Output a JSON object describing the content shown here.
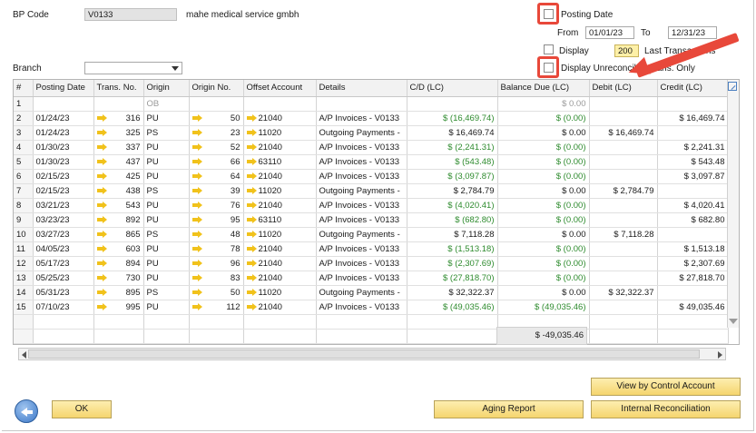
{
  "header": {
    "bp_code_label": "BP Code",
    "bp_code_value": "V0133",
    "bp_name": "mahe medical service gmbh",
    "branch_label": "Branch",
    "branch_value": ""
  },
  "filters": {
    "posting_date_label": "Posting Date",
    "from_label": "From",
    "from_value": "01/01/23",
    "to_label": "To",
    "to_value": "12/31/23",
    "display_label": "Display",
    "display_count": "200",
    "last_transactions_label": "Last Transactions",
    "unreconciled_label": "Display Unreconciled Trans. Only"
  },
  "grid": {
    "columns": [
      "#",
      "Posting Date",
      "Trans. No.",
      "Origin",
      "Origin No.",
      "Offset Account",
      "Details",
      "C/D (LC)",
      "Balance Due (LC)",
      "Debit (LC)",
      "Credit (LC)"
    ],
    "opening_row": {
      "num": "1",
      "origin": "OB",
      "balance_due": "$ 0.00"
    },
    "rows": [
      {
        "num": "2",
        "date": "01/24/23",
        "trans": "316",
        "origin": "PU",
        "origin_no": "50",
        "offset": "21040",
        "details": "A/P Invoices - V0133",
        "cd": "$ (16,469.74)",
        "bal": "$ (0.00)",
        "debit": "",
        "credit": "$ 16,469.74"
      },
      {
        "num": "3",
        "date": "01/24/23",
        "trans": "325",
        "origin": "PS",
        "origin_no": "23",
        "offset": "11020",
        "details": "Outgoing Payments -",
        "cd": "$ 16,469.74",
        "bal": "$ 0.00",
        "debit": "$ 16,469.74",
        "credit": ""
      },
      {
        "num": "4",
        "date": "01/30/23",
        "trans": "337",
        "origin": "PU",
        "origin_no": "52",
        "offset": "21040",
        "details": "A/P Invoices - V0133",
        "cd": "$ (2,241.31)",
        "bal": "$ (0.00)",
        "debit": "",
        "credit": "$ 2,241.31"
      },
      {
        "num": "5",
        "date": "01/30/23",
        "trans": "437",
        "origin": "PU",
        "origin_no": "66",
        "offset": "63110",
        "details": "A/P Invoices - V0133",
        "cd": "$ (543.48)",
        "bal": "$ (0.00)",
        "debit": "",
        "credit": "$ 543.48"
      },
      {
        "num": "6",
        "date": "02/15/23",
        "trans": "425",
        "origin": "PU",
        "origin_no": "64",
        "offset": "21040",
        "details": "A/P Invoices - V0133",
        "cd": "$ (3,097.87)",
        "bal": "$ (0.00)",
        "debit": "",
        "credit": "$ 3,097.87"
      },
      {
        "num": "7",
        "date": "02/15/23",
        "trans": "438",
        "origin": "PS",
        "origin_no": "39",
        "offset": "11020",
        "details": "Outgoing Payments -",
        "cd": "$ 2,784.79",
        "bal": "$ 0.00",
        "debit": "$ 2,784.79",
        "credit": ""
      },
      {
        "num": "8",
        "date": "03/21/23",
        "trans": "543",
        "origin": "PU",
        "origin_no": "76",
        "offset": "21040",
        "details": "A/P Invoices - V0133",
        "cd": "$ (4,020.41)",
        "bal": "$ (0.00)",
        "debit": "",
        "credit": "$ 4,020.41"
      },
      {
        "num": "9",
        "date": "03/23/23",
        "trans": "892",
        "origin": "PU",
        "origin_no": "95",
        "offset": "63110",
        "details": "A/P Invoices - V0133",
        "cd": "$ (682.80)",
        "bal": "$ (0.00)",
        "debit": "",
        "credit": "$ 682.80"
      },
      {
        "num": "10",
        "date": "03/27/23",
        "trans": "865",
        "origin": "PS",
        "origin_no": "48",
        "offset": "11020",
        "details": "Outgoing Payments -",
        "cd": "$ 7,118.28",
        "bal": "$ 0.00",
        "debit": "$ 7,118.28",
        "credit": ""
      },
      {
        "num": "11",
        "date": "04/05/23",
        "trans": "603",
        "origin": "PU",
        "origin_no": "78",
        "offset": "21040",
        "details": "A/P Invoices - V0133",
        "cd": "$ (1,513.18)",
        "bal": "$ (0.00)",
        "debit": "",
        "credit": "$ 1,513.18"
      },
      {
        "num": "12",
        "date": "05/17/23",
        "trans": "894",
        "origin": "PU",
        "origin_no": "96",
        "offset": "21040",
        "details": "A/P Invoices - V0133",
        "cd": "$ (2,307.69)",
        "bal": "$ (0.00)",
        "debit": "",
        "credit": "$ 2,307.69"
      },
      {
        "num": "13",
        "date": "05/25/23",
        "trans": "730",
        "origin": "PU",
        "origin_no": "83",
        "offset": "21040",
        "details": "A/P Invoices - V0133",
        "cd": "$ (27,818.70)",
        "bal": "$ (0.00)",
        "debit": "",
        "credit": "$ 27,818.70"
      },
      {
        "num": "14",
        "date": "05/31/23",
        "trans": "895",
        "origin": "PS",
        "origin_no": "50",
        "offset": "11020",
        "details": "Outgoing Payments -",
        "cd": "$ 32,322.37",
        "bal": "$ 0.00",
        "debit": "$ 32,322.37",
        "credit": ""
      },
      {
        "num": "15",
        "date": "07/10/23",
        "trans": "995",
        "origin": "PU",
        "origin_no": "112",
        "offset": "21040",
        "details": "A/P Invoices - V0133",
        "cd": "$ (49,035.46)",
        "bal": "$ (49,035.46)",
        "debit": "",
        "credit": "$ 49,035.46"
      }
    ],
    "total_balance_due": "$ -49,035.46"
  },
  "buttons": {
    "ok": "OK",
    "aging_report": "Aging Report",
    "view_by_control_account": "View by Control Account",
    "internal_reconciliation": "Internal Reconciliation"
  },
  "colors": {
    "accent_button": "#f5d56e",
    "highlight_red": "#e8483a",
    "positive_green": "#2e8b2e"
  }
}
